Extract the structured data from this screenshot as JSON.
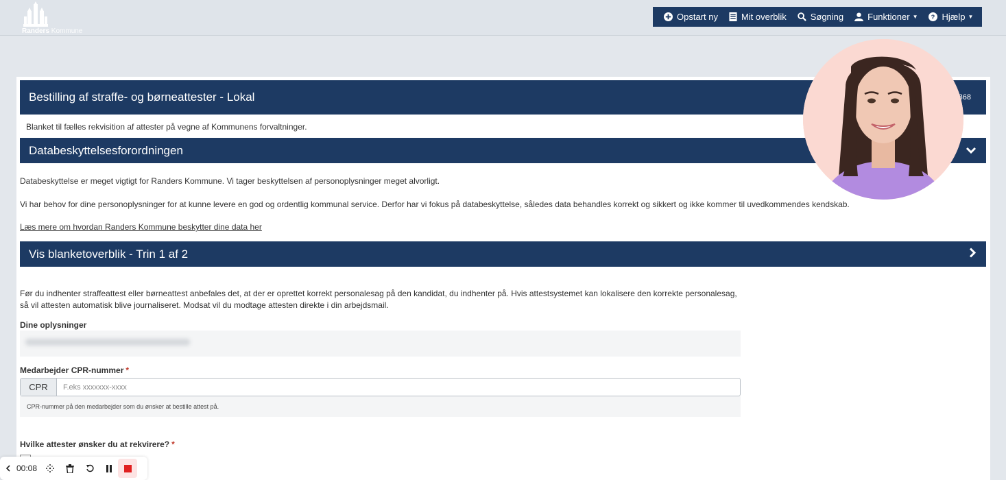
{
  "header": {
    "logo": {
      "brand_bold": "Randers",
      "brand_rest": "Kommune"
    },
    "nav": [
      {
        "label": "Opstart ny",
        "icon": "plus-circle-icon"
      },
      {
        "label": "Mit overblik",
        "icon": "list-icon"
      },
      {
        "label": "Søgning",
        "icon": "search-icon"
      },
      {
        "label": "Funktioner",
        "icon": "user-icon",
        "dropdown": true
      },
      {
        "label": "Hjælp",
        "icon": "question-circle-icon",
        "dropdown": true
      }
    ]
  },
  "form": {
    "title": "Bestilling af straffe- og børneattester - Lokal",
    "form_number": "368",
    "description": "Blanket til fælles rekvisition af attester på vegne af Kommunens forvaltninger.",
    "gdpr": {
      "heading": "Databeskyttelsesforordningen",
      "p1": "Databeskyttelse er meget vigtigt for Randers Kommune. Vi tager beskyttelsen af personoplysninger meget alvorligt.",
      "p2": "Vi har behov for dine personoplysninger for at kunne levere en god og ordentlig kommunal service. Derfor har vi fokus på databeskyttelse, således data behandles korrekt og sikkert og ikke kommer til uvedkommendes kendskab.",
      "link": "Læs mere om hvordan Randers Kommune beskytter dine data her"
    },
    "overview": {
      "heading": "Vis blanketoverblik - Trin 1 af 2"
    },
    "intro_line1": "Før du indhenter straffeattest eller børneattest anbefales det, at der er oprettet korrekt personalesag på den kandidat, du indhenter på. Hvis attestsystemet kan lokalisere den korrekte personalesag,",
    "intro_line2": "så vil attesten automatisk blive journaliseret. Modsat vil du modtage attesten direkte i din arbejdsmail.",
    "your_info_label": "Dine oplysninger",
    "cpr": {
      "label": "Medarbejder CPR-nummer",
      "required_mark": "*",
      "addon": "CPR",
      "placeholder": "F.eks xxxxxxx-xxxx",
      "help": "CPR-nummer på den medarbejder som du ønsker at bestille attest på."
    },
    "certificates": {
      "label": "Hvilke attester ønsker du at rekvirere?",
      "required_mark": "*"
    }
  },
  "recorder": {
    "time": "00:08"
  },
  "colors": {
    "navy": "#1d3a63",
    "required": "#c0392b",
    "background": "#e3e7ec"
  }
}
